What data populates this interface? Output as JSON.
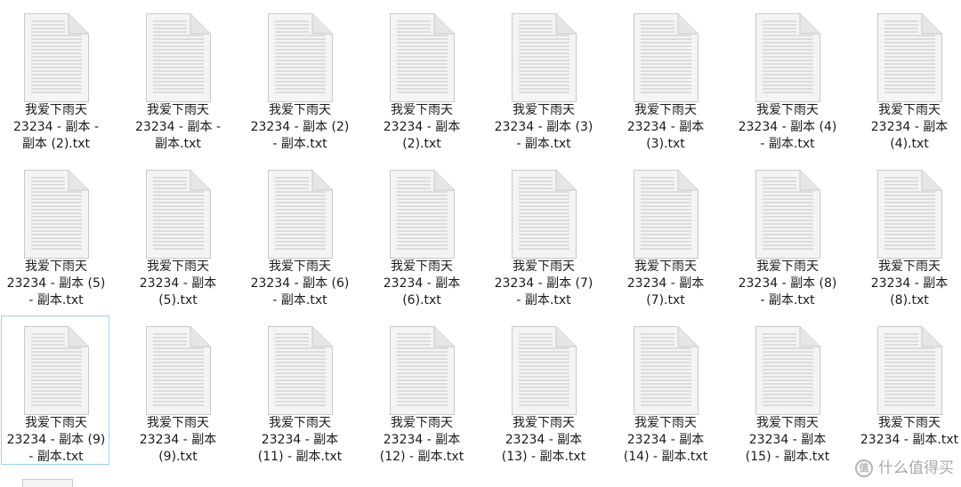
{
  "window": {
    "view": "large-icons",
    "selected_file": "我爱下雨天23234 - 副本 (9) - 副本.txt"
  },
  "files": [
    {
      "name": "我爱下雨天23234 - 副本 - 副本 (2).txt",
      "lines": [
        "我爱下雨天",
        "23234 - 副本 -",
        "副本 (2).txt"
      ],
      "icon": "text-document-icon"
    },
    {
      "name": "我爱下雨天23234 - 副本 - 副本.txt",
      "lines": [
        "我爱下雨天",
        "23234 - 副本 -",
        "副本.txt"
      ],
      "icon": "text-document-icon"
    },
    {
      "name": "我爱下雨天23234 - 副本 (2) - 副本.txt",
      "lines": [
        "我爱下雨天",
        "23234 - 副本 (2)",
        "- 副本.txt"
      ],
      "icon": "text-document-icon"
    },
    {
      "name": "我爱下雨天23234 - 副本 (2).txt",
      "lines": [
        "我爱下雨天",
        "23234 - 副本",
        "(2).txt"
      ],
      "icon": "text-document-icon"
    },
    {
      "name": "我爱下雨天23234 - 副本 (3) - 副本.txt",
      "lines": [
        "我爱下雨天",
        "23234 - 副本 (3)",
        "- 副本.txt"
      ],
      "icon": "text-document-icon"
    },
    {
      "name": "我爱下雨天23234 - 副本 (3).txt",
      "lines": [
        "我爱下雨天",
        "23234 - 副本",
        "(3).txt"
      ],
      "icon": "text-document-icon"
    },
    {
      "name": "我爱下雨天23234 - 副本 (4) - 副本.txt",
      "lines": [
        "我爱下雨天",
        "23234 - 副本 (4)",
        "- 副本.txt"
      ],
      "icon": "text-document-icon"
    },
    {
      "name": "我爱下雨天23234 - 副本 (4).txt",
      "lines": [
        "我爱下雨天",
        "23234 - 副本",
        "(4).txt"
      ],
      "icon": "text-document-icon"
    },
    {
      "name": "我爱下雨天23234 - 副本 (5) - 副本.txt",
      "lines": [
        "我爱下雨天",
        "23234 - 副本 (5)",
        "- 副本.txt"
      ],
      "icon": "text-document-icon"
    },
    {
      "name": "我爱下雨天23234 - 副本 (5).txt",
      "lines": [
        "我爱下雨天",
        "23234 - 副本",
        "(5).txt"
      ],
      "icon": "text-document-icon"
    },
    {
      "name": "我爱下雨天23234 - 副本 (6) - 副本.txt",
      "lines": [
        "我爱下雨天",
        "23234 - 副本 (6)",
        "- 副本.txt"
      ],
      "icon": "text-document-icon"
    },
    {
      "name": "我爱下雨天23234 - 副本 (6).txt",
      "lines": [
        "我爱下雨天",
        "23234 - 副本",
        "(6).txt"
      ],
      "icon": "text-document-icon"
    },
    {
      "name": "我爱下雨天23234 - 副本 (7) - 副本.txt",
      "lines": [
        "我爱下雨天",
        "23234 - 副本 (7)",
        "- 副本.txt"
      ],
      "icon": "text-document-icon"
    },
    {
      "name": "我爱下雨天23234 - 副本 (7).txt",
      "lines": [
        "我爱下雨天",
        "23234 - 副本",
        "(7).txt"
      ],
      "icon": "text-document-icon"
    },
    {
      "name": "我爱下雨天23234 - 副本 (8) - 副本.txt",
      "lines": [
        "我爱下雨天",
        "23234 - 副本 (8)",
        "- 副本.txt"
      ],
      "icon": "text-document-icon"
    },
    {
      "name": "我爱下雨天23234 - 副本 (8).txt",
      "lines": [
        "我爱下雨天",
        "23234 - 副本",
        "(8).txt"
      ],
      "icon": "text-document-icon"
    },
    {
      "name": "我爱下雨天23234 - 副本 (9) - 副本.txt",
      "lines": [
        "我爱下雨天",
        "23234 - 副本 (9)",
        "- 副本.txt"
      ],
      "icon": "text-document-icon",
      "selected": true
    },
    {
      "name": "我爱下雨天23234 - 副本 (9).txt",
      "lines": [
        "我爱下雨天",
        "23234 - 副本",
        "(9).txt"
      ],
      "icon": "text-document-icon"
    },
    {
      "name": "我爱下雨天23234 - 副本 (11) - 副本.txt",
      "lines": [
        "我爱下雨天",
        "23234 - 副本",
        "(11) - 副本.txt"
      ],
      "icon": "text-document-icon"
    },
    {
      "name": "我爱下雨天23234 - 副本 (12) - 副本.txt",
      "lines": [
        "我爱下雨天",
        "23234 - 副本",
        "(12) - 副本.txt"
      ],
      "icon": "text-document-icon"
    },
    {
      "name": "我爱下雨天23234 - 副本 (13) - 副本.txt",
      "lines": [
        "我爱下雨天",
        "23234 - 副本",
        "(13) - 副本.txt"
      ],
      "icon": "text-document-icon"
    },
    {
      "name": "我爱下雨天23234 - 副本 (14) - 副本.txt",
      "lines": [
        "我爱下雨天",
        "23234 - 副本",
        "(14) - 副本.txt"
      ],
      "icon": "text-document-icon"
    },
    {
      "name": "我爱下雨天23234 - 副本 (15) - 副本.txt",
      "lines": [
        "我爱下雨天",
        "23234 - 副本",
        "(15) - 副本.txt"
      ],
      "icon": "text-document-icon"
    },
    {
      "name": "我爱下雨天23234 - 副本.txt",
      "lines": [
        "我爱下雨天",
        "23234 - 副本.txt"
      ],
      "icon": "text-document-icon"
    }
  ],
  "watermark": {
    "badge": "值",
    "text": "什么值得买"
  },
  "colors": {
    "selection_border": "#99d1ff",
    "icon_page": "#f4f4f4",
    "icon_border": "#c9c9c9",
    "icon_lines": "#c3c3c3",
    "label_text": "#1a1a1a"
  }
}
